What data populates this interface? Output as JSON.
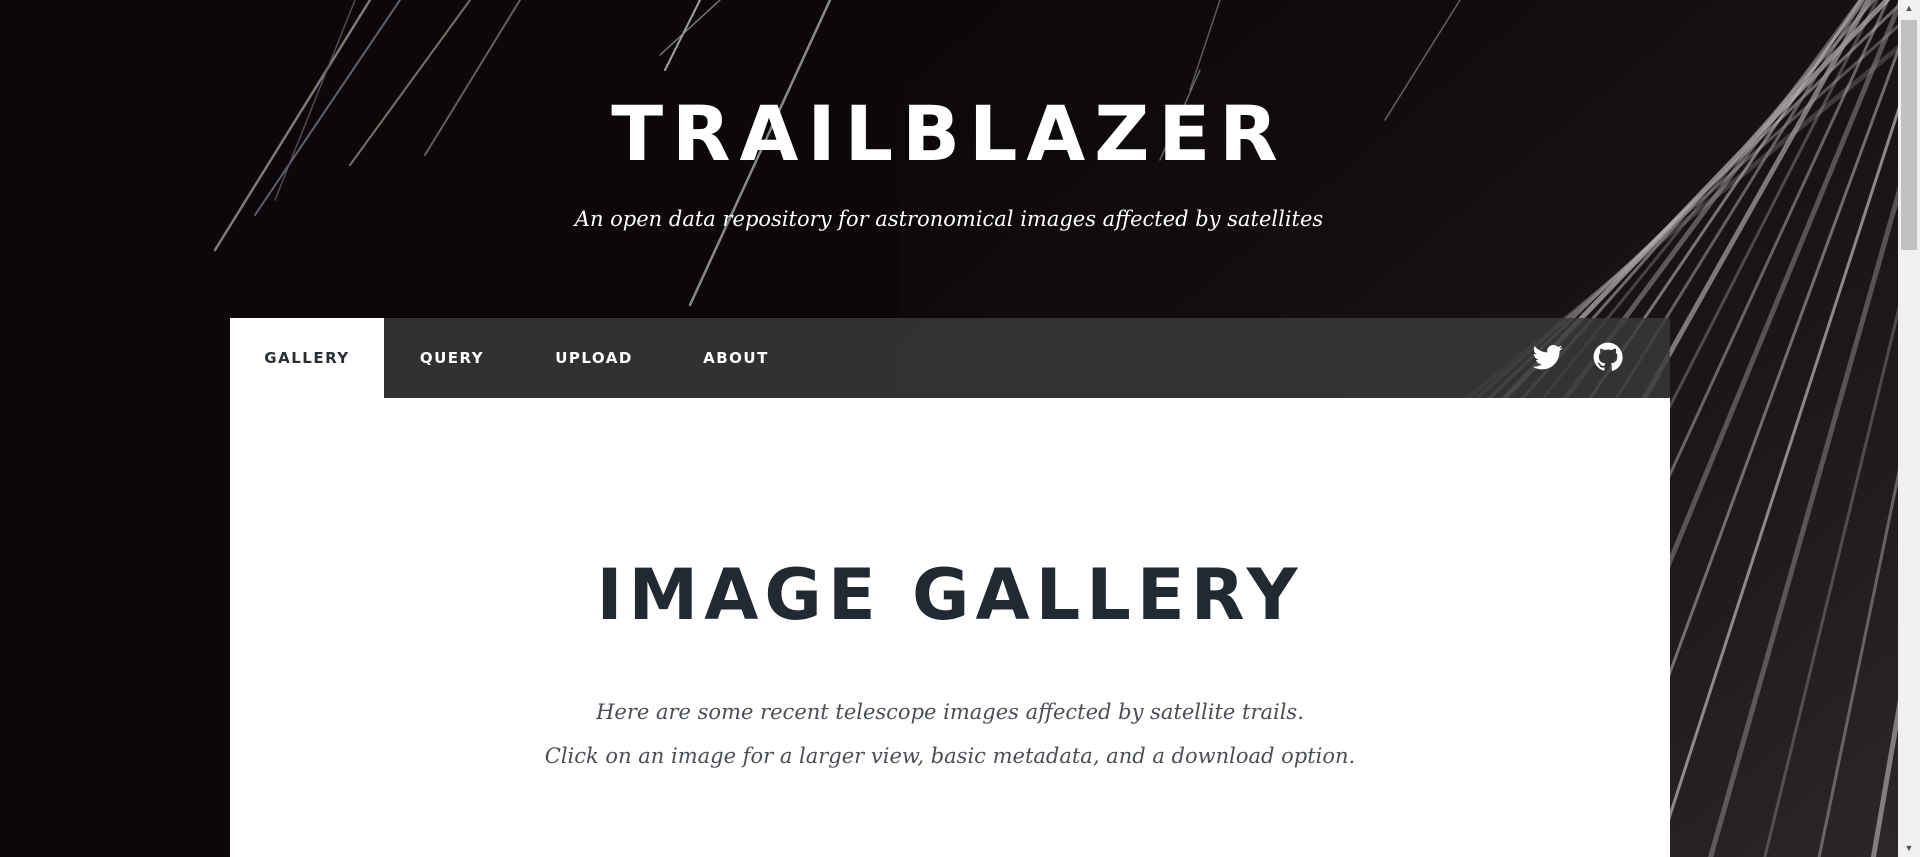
{
  "site": {
    "title": "TRAILBLAZER",
    "subtitle": "An open data repository for astronomical images affected by satellites"
  },
  "nav": {
    "items": [
      {
        "label": "GALLERY",
        "active": true
      },
      {
        "label": "QUERY",
        "active": false
      },
      {
        "label": "UPLOAD",
        "active": false
      },
      {
        "label": "ABOUT",
        "active": false
      }
    ],
    "social_icons": [
      "twitter-icon",
      "github-icon"
    ]
  },
  "main": {
    "title": "IMAGE GALLERY",
    "intro_line1": "Here are some recent telescope images affected by satellite trails.",
    "intro_line2": "Click on an image for a larger view, basic metadata, and a download option."
  },
  "colors": {
    "background": "#0c0809",
    "nav_bar": "#3c393a",
    "panel": "#ffffff",
    "title_text": "#212a33"
  }
}
